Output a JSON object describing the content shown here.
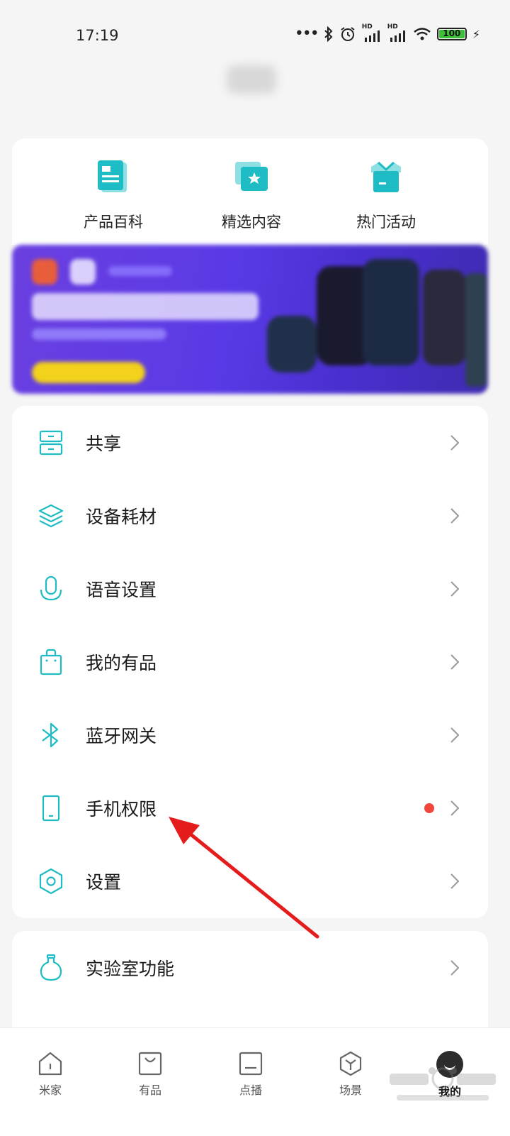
{
  "status_bar": {
    "time": "17:19",
    "battery_level": "100",
    "hd1": "HD",
    "hd2": "HD"
  },
  "quick_links": [
    {
      "label": "产品百科",
      "icon": "product-encyclopedia-icon"
    },
    {
      "label": "精选内容",
      "icon": "featured-content-icon"
    },
    {
      "label": "热门活动",
      "icon": "popular-events-icon"
    }
  ],
  "menu": [
    {
      "label": "共享",
      "icon": "share-icon"
    },
    {
      "label": "设备耗材",
      "icon": "layers-icon"
    },
    {
      "label": "语音设置",
      "icon": "microphone-icon"
    },
    {
      "label": "我的有品",
      "icon": "shopping-bag-icon"
    },
    {
      "label": "蓝牙网关",
      "icon": "bluetooth-icon"
    },
    {
      "label": "手机权限",
      "icon": "phone-icon",
      "badge": "red-dot"
    },
    {
      "label": "设置",
      "icon": "settings-hexagon-icon"
    }
  ],
  "lab": {
    "label": "实验室功能",
    "icon": "flask-icon"
  },
  "tabs": [
    {
      "label": "米家",
      "icon": "home-icon"
    },
    {
      "label": "有品",
      "icon": "bag-icon"
    },
    {
      "label": "点播",
      "icon": "media-icon"
    },
    {
      "label": "场景",
      "icon": "scene-cube-icon"
    },
    {
      "label": "我的",
      "icon": "avatar-icon",
      "active": true
    }
  ],
  "colors": {
    "accent": "#1ebcc4",
    "badge": "#f0463c",
    "arrow": "#e51c1c"
  }
}
